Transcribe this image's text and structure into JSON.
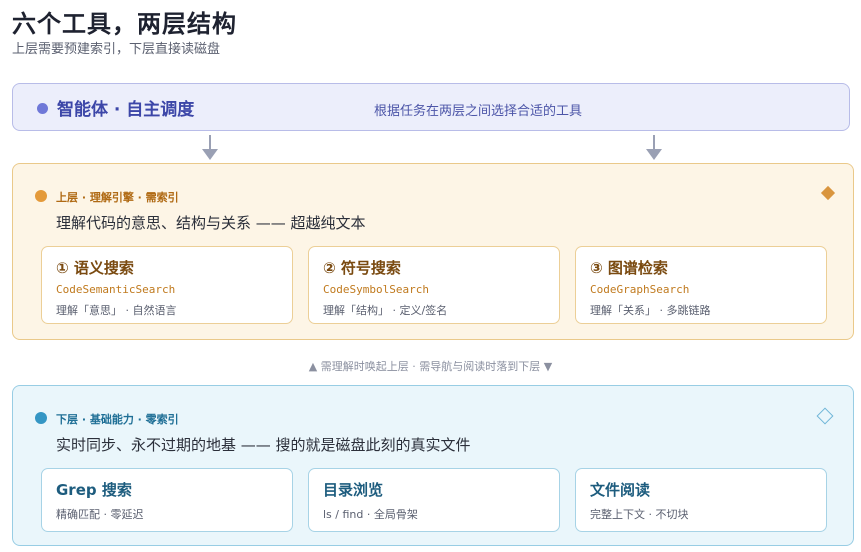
{
  "title": "六个工具，两层结构",
  "subtitle": "上层需要预建索引，下层直接读磁盘",
  "agent": {
    "name": "智能体 · 自主调度",
    "description": "根据任务在两层之间选择合适的工具"
  },
  "upper": {
    "tag": "上层 · 理解引擎 · 需索引",
    "headline": "理解代码的意思、结构与关系 —— 超越纯文本",
    "cards": [
      {
        "title": "① 语义搜索",
        "code": "CodeSemanticSearch",
        "desc": "理解「意思」 · 自然语言"
      },
      {
        "title": "② 符号搜索",
        "code": "CodeSymbolSearch",
        "desc": "理解「结构」 · 定义/签名"
      },
      {
        "title": "③ 图谱检索",
        "code": "CodeGraphSearch",
        "desc": "理解「关系」 · 多跳链路"
      }
    ]
  },
  "between": "▲ 需理解时唤起上层    ·    需导航与阅读时落到下层 ▼",
  "lower": {
    "tag": "下层 · 基础能力 · 零索引",
    "headline": "实时同步、永不过期的地基 —— 搜的就是磁盘此刻的真实文件",
    "cards": [
      {
        "title": "Grep 搜索",
        "desc": "精确匹配 · 零延迟"
      },
      {
        "title": "目录浏览",
        "desc": "ls / find · 全局骨架"
      },
      {
        "title": "文件阅读",
        "desc": "完整上下文 · 不切块"
      }
    ]
  },
  "colors": {
    "agent_accent": "#6f78d8",
    "upper_accent": "#e49a3a",
    "lower_accent": "#3596c4"
  },
  "icons": [
    "agent-dot-icon",
    "upper-dot-icon",
    "upper-diamond-icon",
    "lower-dot-icon",
    "lower-diamond-outline-icon",
    "down-arrow-icon"
  ]
}
